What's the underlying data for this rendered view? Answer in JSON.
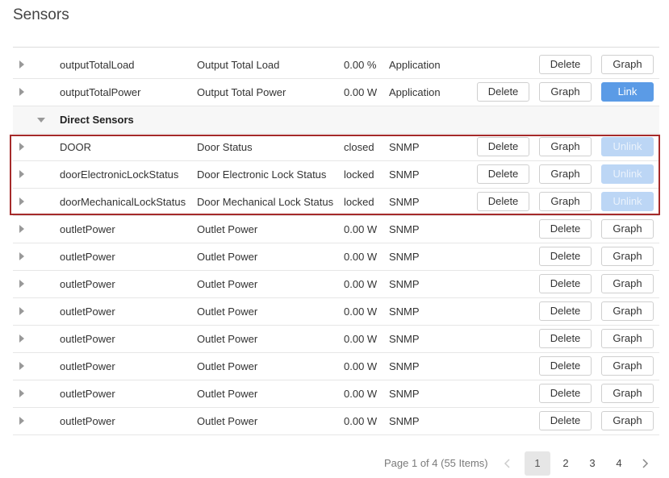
{
  "page": {
    "title": "Sensors"
  },
  "group": {
    "label": "Direct Sensors"
  },
  "buttons": {
    "delete": "Delete",
    "graph": "Graph",
    "link": "Link",
    "unlink": "Unlink"
  },
  "rows": [
    {
      "name": "outputTotalLoad",
      "description": "Output Total Load",
      "value": "0.00 %",
      "source": "Application"
    },
    {
      "name": "outputTotalPower",
      "description": "Output Total Power",
      "value": "0.00 W",
      "source": "Application"
    },
    {
      "name": "DOOR",
      "description": "Door Status",
      "value": "closed",
      "source": "SNMP"
    },
    {
      "name": "doorElectronicLockStatus",
      "description": "Door Electronic Lock Status",
      "value": "locked",
      "source": "SNMP"
    },
    {
      "name": "doorMechanicalLockStatus",
      "description": "Door Mechanical Lock Status",
      "value": "locked",
      "source": "SNMP"
    },
    {
      "name": "outletPower",
      "description": "Outlet Power",
      "value": "0.00 W",
      "source": "SNMP"
    },
    {
      "name": "outletPower",
      "description": "Outlet Power",
      "value": "0.00 W",
      "source": "SNMP"
    },
    {
      "name": "outletPower",
      "description": "Outlet Power",
      "value": "0.00 W",
      "source": "SNMP"
    },
    {
      "name": "outletPower",
      "description": "Outlet Power",
      "value": "0.00 W",
      "source": "SNMP"
    },
    {
      "name": "outletPower",
      "description": "Outlet Power",
      "value": "0.00 W",
      "source": "SNMP"
    },
    {
      "name": "outletPower",
      "description": "Outlet Power",
      "value": "0.00 W",
      "source": "SNMP"
    },
    {
      "name": "outletPower",
      "description": "Outlet Power",
      "value": "0.00 W",
      "source": "SNMP"
    },
    {
      "name": "outletPower",
      "description": "Outlet Power",
      "value": "0.00 W",
      "source": "SNMP"
    }
  ],
  "pagination": {
    "info": "Page 1 of 4 (55 Items)",
    "pages": [
      "1",
      "2",
      "3",
      "4"
    ],
    "current": "1"
  },
  "colors": {
    "link": "#5b9be6",
    "unlink": "#bcd6f5",
    "highlight": "#a52a2a"
  },
  "icons": {
    "expand": "caret-right-icon",
    "collapse": "caret-down-icon",
    "prev": "chevron-left-icon",
    "next": "chevron-right-icon"
  }
}
